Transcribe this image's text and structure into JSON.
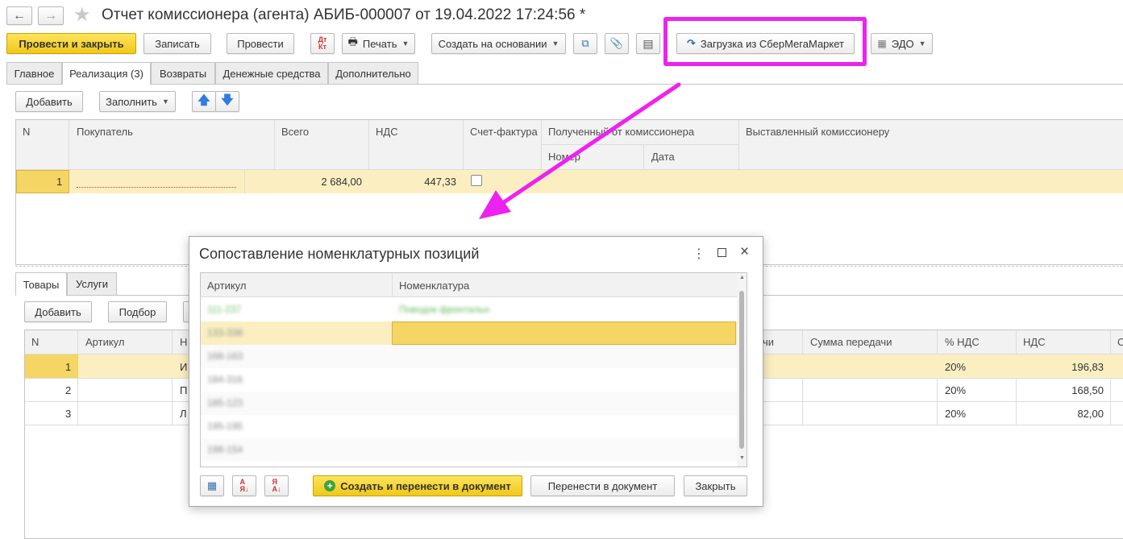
{
  "window": {
    "title": "Отчет комиссионера (агента) АБИБ-000007 от 19.04.2022 17:24:56 *"
  },
  "toolbar": {
    "post_close": "Провести и закрыть",
    "save": "Записать",
    "post": "Провести",
    "dt_kt": "Дт Кт",
    "print": "Печать",
    "create_based": "Создать на основании",
    "load_sber": "Загрузка из СберМегаМаркет",
    "edo": "ЭДО"
  },
  "tabs": [
    "Главное",
    "Реализация (3)",
    "Возвраты",
    "Денежные средства",
    "Дополнительно"
  ],
  "sales": {
    "add": "Добавить",
    "fill": "Заполнить",
    "columns": {
      "n": "N",
      "buyer": "Покупатель",
      "total": "Всего",
      "vat": "НДС",
      "invoice": "Счет-фактура",
      "received": "Полученный от комиссионера",
      "number": "Номер",
      "date": "Дата",
      "issued": "Выставленный комиссионеру"
    },
    "rows": [
      {
        "n": "1",
        "buyer": "",
        "total": "2 684,00",
        "vat": "447,33"
      }
    ]
  },
  "lower": {
    "tabs": [
      "Товары",
      "Услуги"
    ],
    "add": "Добавить",
    "select": "Подбор",
    "columns": {
      "n": "N",
      "article": "Артикул",
      "nom": "Н",
      "transfer": "чи",
      "transfer_sum": "Сумма передачи",
      "vat_rate": "% НДС",
      "vat": "НДС",
      "extra": "С"
    },
    "rows": [
      {
        "n": "1",
        "nom": "И",
        "vat_rate": "20%",
        "vat": "196,83"
      },
      {
        "n": "2",
        "nom": "П",
        "vat_rate": "20%",
        "vat": "168,50"
      },
      {
        "n": "3",
        "nom": "Л",
        "vat_rate": "20%",
        "vat": "82,00"
      }
    ]
  },
  "dialog": {
    "title": "Сопоставление номенклатурных позиций",
    "columns": {
      "article": "Артикул",
      "nomenclature": "Номенклатура"
    },
    "rows": [
      {
        "article": "111-237",
        "nomenclature": "Поводок фронтальн"
      },
      {
        "article": "133-338",
        "nomenclature": ""
      },
      {
        "article": "168-163",
        "nomenclature": ""
      },
      {
        "article": "184-316",
        "nomenclature": ""
      },
      {
        "article": "185-123",
        "nomenclature": ""
      },
      {
        "article": "195-195",
        "nomenclature": ""
      },
      {
        "article": "198-154",
        "nomenclature": ""
      }
    ],
    "create_transfer": "Создать и перенести в документ",
    "transfer": "Перенести в документ",
    "close": "Закрыть"
  },
  "colors": {
    "accent_yellow": "#f5d13a",
    "row_highlight": "#fbefc2",
    "annotation_magenta": "#ee22ee"
  }
}
